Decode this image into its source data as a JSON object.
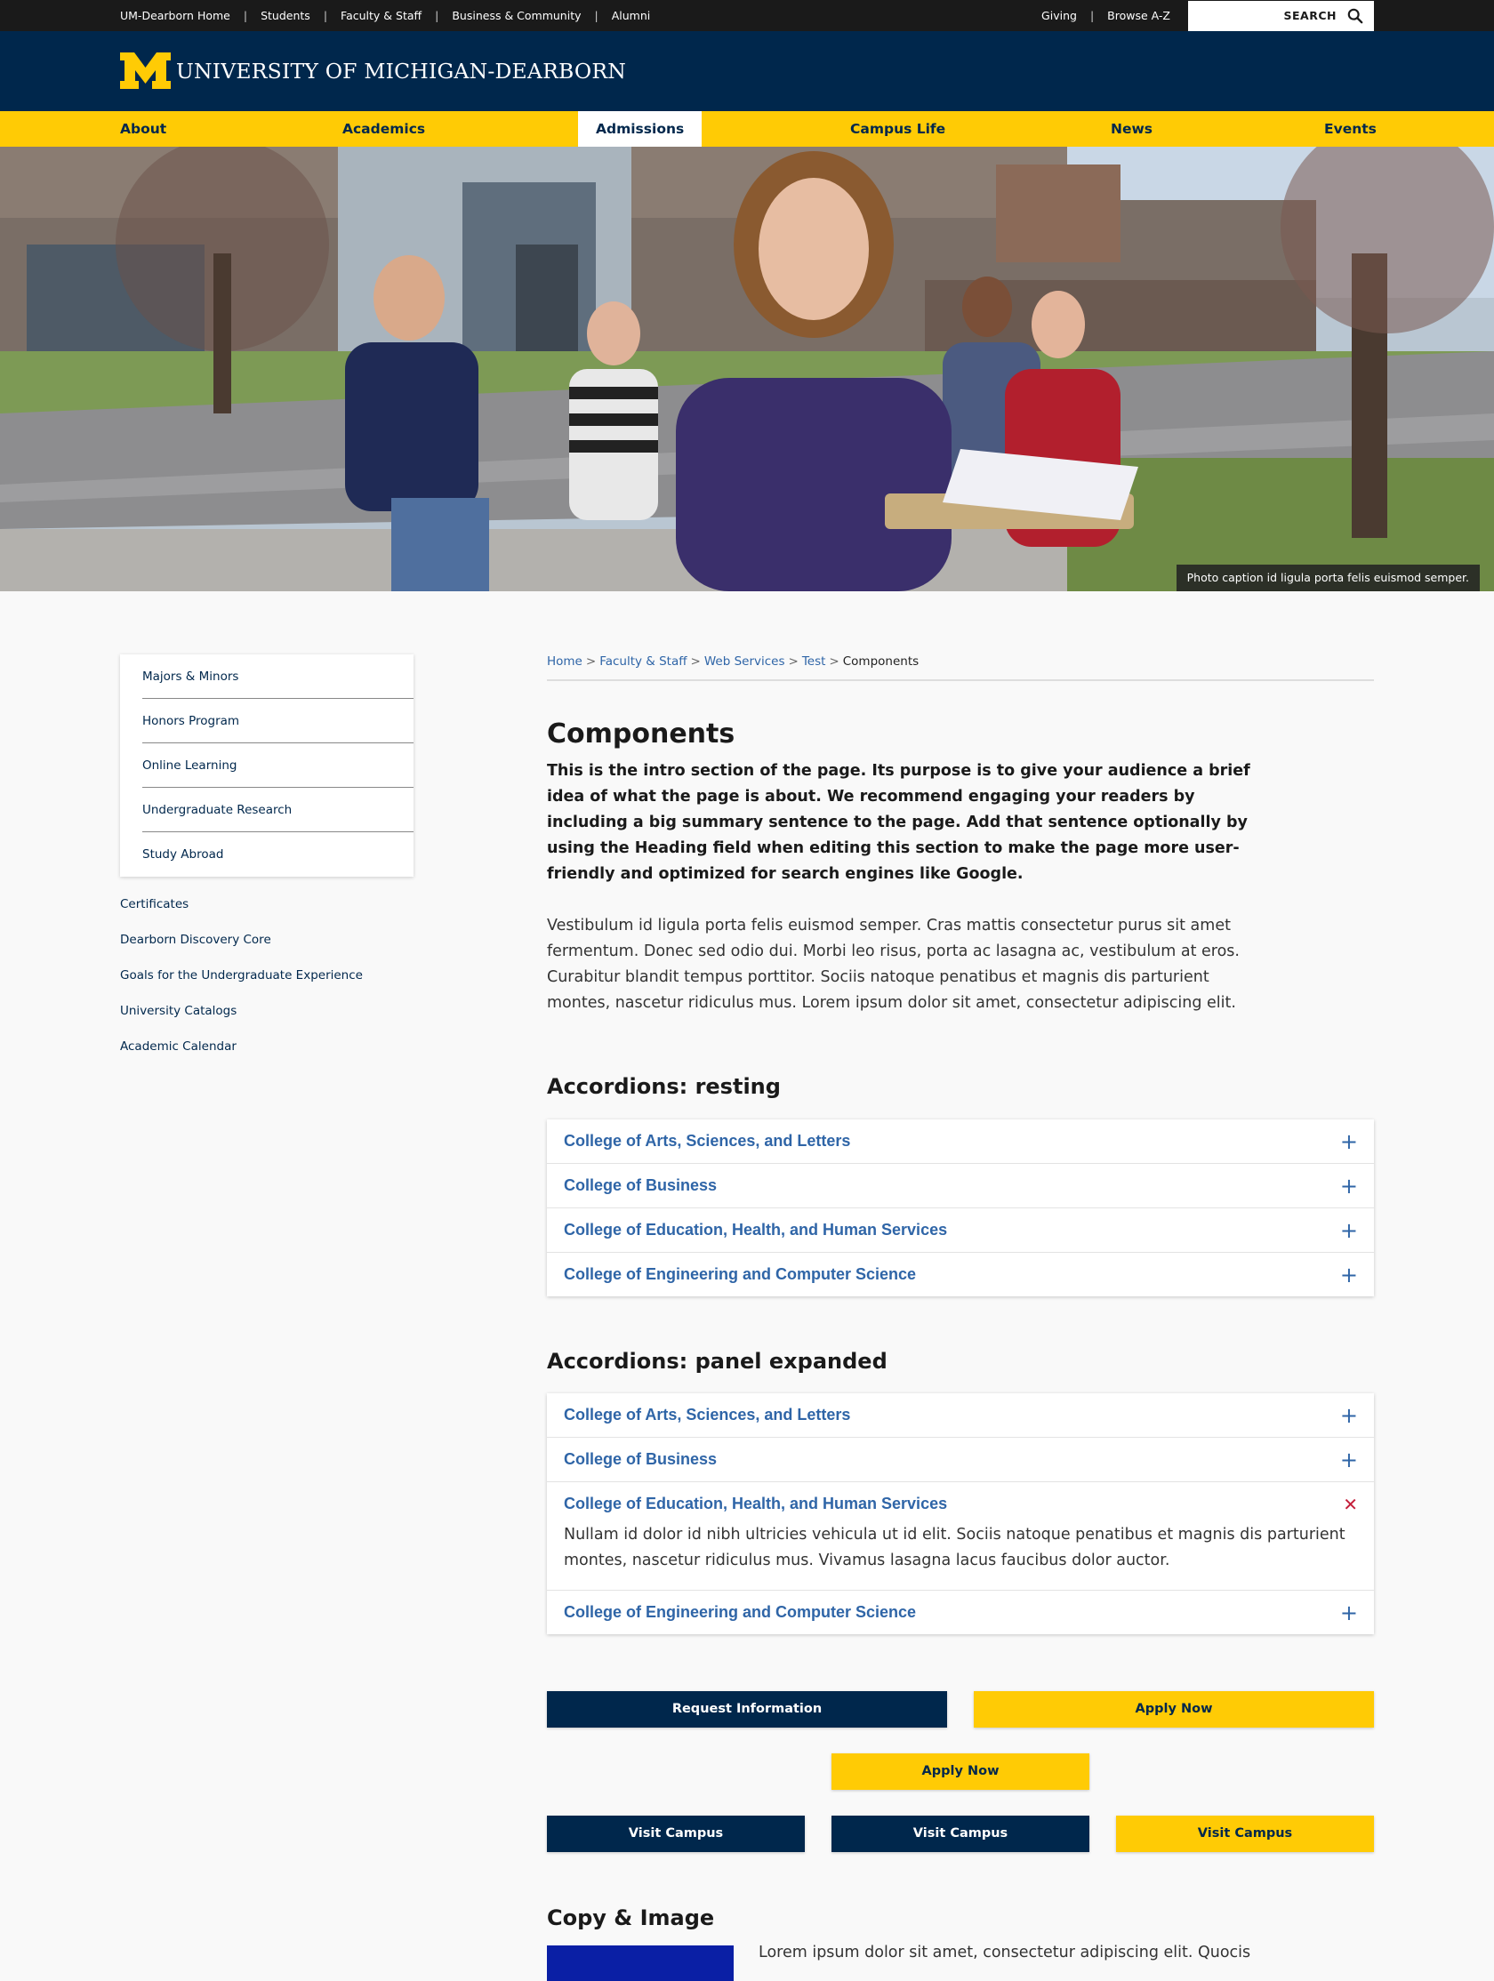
{
  "utility": {
    "links": [
      "UM-Dearborn Home",
      "Students",
      "Faculty & Staff",
      "Business & Community",
      "Alumni"
    ],
    "right_links": [
      "Giving",
      "Browse A-Z"
    ],
    "search_label": "SEARCH"
  },
  "brand": {
    "wordmark": "UNIVERSITY OF MICHIGAN-DEARBORN"
  },
  "nav": {
    "items": [
      "About",
      "Academics",
      "Admissions",
      "Campus Life",
      "News",
      "Events"
    ],
    "active": "Admissions"
  },
  "hero": {
    "caption": "Photo caption id ligula porta felis euismod semper."
  },
  "sidebar": {
    "boxed": [
      "Majors & Minors",
      "Honors Program",
      "Online Learning",
      "Undergraduate Research",
      "Study Abroad"
    ],
    "plain": [
      "Certificates",
      "Dearborn Discovery Core",
      "Goals for the Undergraduate Experience",
      "University Catalogs",
      "Academic Calendar"
    ]
  },
  "breadcrumb": [
    "Home",
    "Faculty & Staff",
    "Web Services",
    "Test",
    "Components"
  ],
  "page": {
    "title": "Components",
    "intro": "This is the intro section of the page. Its purpose is to give your audience a brief idea of what the page is about. We recommend engaging your readers by including a big summary sentence to the page. Add that sentence optionally by using the Heading field when editing this section to make the page more user-friendly and optimized for search engines like Google.",
    "body": "Vestibulum id ligula porta felis euismod semper. Cras mattis consectetur purus sit amet fermentum. Donec sed odio dui. Morbi leo risus, porta ac lasagna ac, vestibulum at eros. Curabitur blandit tempus porttitor. Sociis natoque penatibus et magnis dis parturient montes, nascetur ridiculus mus. Lorem ipsum dolor sit amet, consectetur adipiscing elit."
  },
  "accordions_resting": {
    "title": "Accordions: resting",
    "items": [
      "College of Arts, Sciences, and Letters",
      "College of Business",
      "College of Education, Health, and Human Services",
      "College of Engineering and Computer Science"
    ]
  },
  "accordions_expanded": {
    "title": "Accordions: panel expanded",
    "items": [
      "College of Arts, Sciences, and Letters",
      "College of Business",
      "College of Education, Health, and Human Services",
      "College of Engineering and Computer Science"
    ],
    "panel_text": "Nullam id dolor id nibh ultricies vehicula ut id elit. Sociis natoque penatibus et magnis dis parturient montes, nascetur ridiculus mus. Vivamus lasagna lacus faucibus dolor auctor."
  },
  "buttons": {
    "request_info": "Request Information",
    "apply_now": "Apply Now",
    "visit_campus": "Visit Campus"
  },
  "copy_image": {
    "title": "Copy & Image",
    "text": "Lorem ipsum dolor sit amet, consectetur adipiscing elit. Quocis"
  },
  "colors": {
    "navy": "#00274c",
    "maize": "#ffcb05",
    "link_blue": "#2f65a7",
    "close_red": "#c41e3a"
  }
}
